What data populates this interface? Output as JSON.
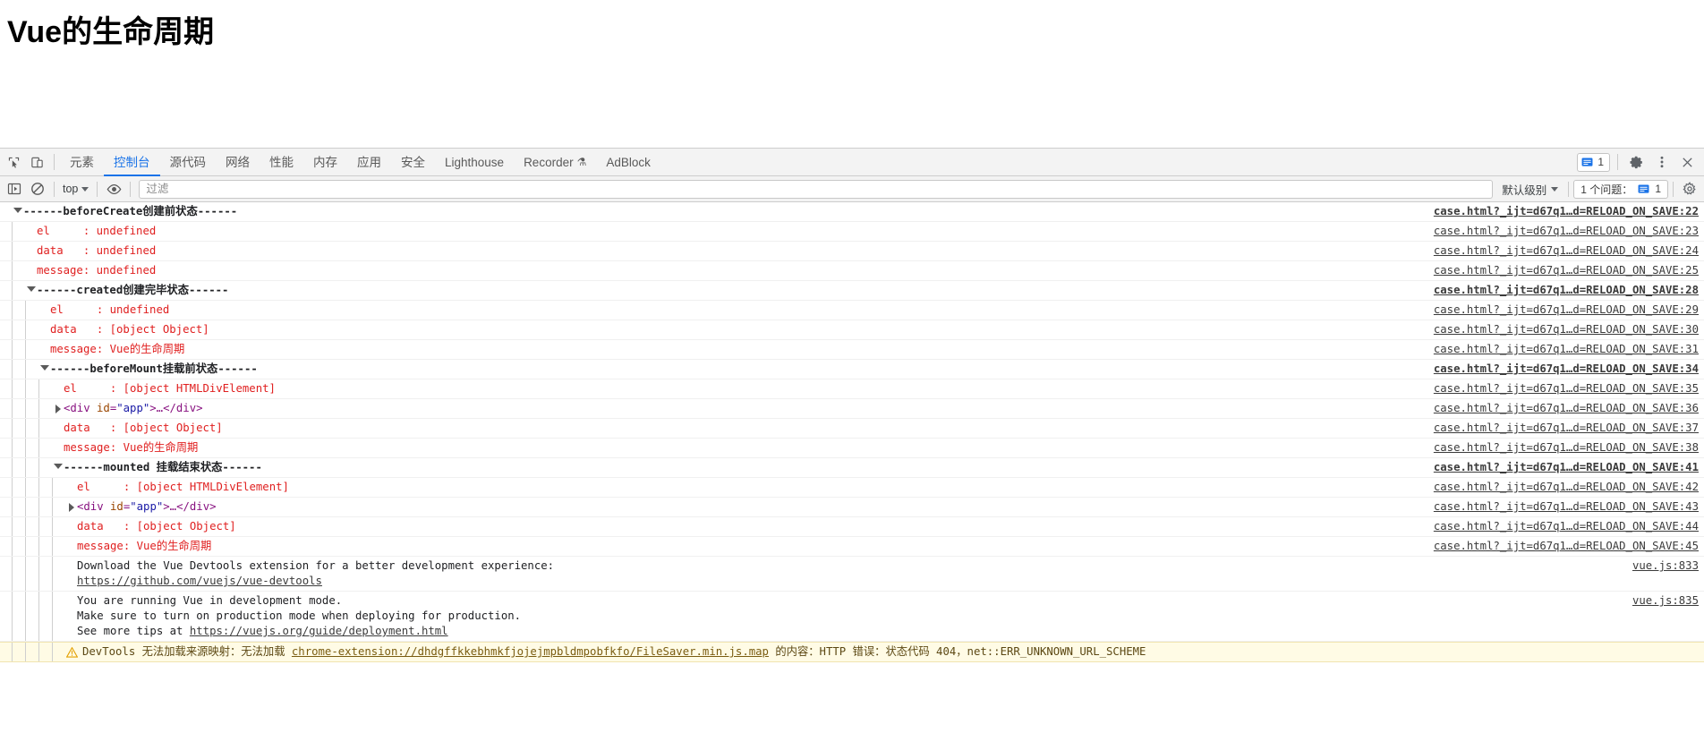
{
  "page": {
    "title": "Vue的生命周期"
  },
  "devtools": {
    "toolbar": {
      "inspect_icon": "inspect-cursor-icon",
      "device_toolbar_icon": "device-toggle-icon",
      "tabs": [
        {
          "label": "元素",
          "active": false
        },
        {
          "label": "控制台",
          "active": true
        },
        {
          "label": "源代码",
          "active": false
        },
        {
          "label": "网络",
          "active": false
        },
        {
          "label": "性能",
          "active": false
        },
        {
          "label": "内存",
          "active": false
        },
        {
          "label": "应用",
          "active": false
        },
        {
          "label": "安全",
          "active": false
        },
        {
          "label": "Lighthouse",
          "active": false
        },
        {
          "label": "Recorder",
          "active": false,
          "badge": "⚗"
        },
        {
          "label": "AdBlock",
          "active": false
        }
      ],
      "message_count": "1",
      "settings_icon": "gear-icon",
      "more_icon": "more-vertical-icon",
      "close_icon": "close-icon"
    },
    "filterbar": {
      "sidebar_icon": "console-sidebar-icon",
      "clear_icon": "clear-console-icon",
      "context": "top",
      "eye_icon": "live-expression-eye-icon",
      "filter_placeholder": "过滤",
      "filter_value": "",
      "level": "默认级别",
      "issues_label": "1 个问题：",
      "issues_count": "1",
      "settings_icon": "gear-icon"
    },
    "console": {
      "rows": [
        {
          "id": "r1",
          "indent": 0,
          "disclosure": "down",
          "kind": "group",
          "text": "------beforeCreate创建前状态------",
          "source": "case.html?_ijt=d67q1…d=RELOAD_ON_SAVE:22",
          "source_bold": true
        },
        {
          "id": "r2",
          "indent": 1,
          "disclosure": "none",
          "kind": "err",
          "text": "el     : undefined",
          "source": "case.html?_ijt=d67q1…d=RELOAD_ON_SAVE:23",
          "source_bold": false
        },
        {
          "id": "r3",
          "indent": 1,
          "disclosure": "none",
          "kind": "err",
          "text": "data   : undefined",
          "source": "case.html?_ijt=d67q1…d=RELOAD_ON_SAVE:24",
          "source_bold": false
        },
        {
          "id": "r4",
          "indent": 1,
          "disclosure": "none",
          "kind": "err",
          "text": "message: undefined",
          "source": "case.html?_ijt=d67q1…d=RELOAD_ON_SAVE:25",
          "source_bold": false
        },
        {
          "id": "r5",
          "indent": 1,
          "disclosure": "down",
          "kind": "group",
          "text": "------created创建完毕状态------",
          "source": "case.html?_ijt=d67q1…d=RELOAD_ON_SAVE:28",
          "source_bold": true
        },
        {
          "id": "r6",
          "indent": 2,
          "disclosure": "none",
          "kind": "err",
          "text": "el     : undefined",
          "source": "case.html?_ijt=d67q1…d=RELOAD_ON_SAVE:29",
          "source_bold": false
        },
        {
          "id": "r7",
          "indent": 2,
          "disclosure": "none",
          "kind": "err",
          "text": "data   : [object Object]",
          "source": "case.html?_ijt=d67q1…d=RELOAD_ON_SAVE:30",
          "source_bold": false
        },
        {
          "id": "r8",
          "indent": 2,
          "disclosure": "none",
          "kind": "err",
          "text": "message: Vue的生命周期",
          "source": "case.html?_ijt=d67q1…d=RELOAD_ON_SAVE:31",
          "source_bold": false
        },
        {
          "id": "r9",
          "indent": 2,
          "disclosure": "down",
          "kind": "group",
          "text": "------beforeMount挂载前状态------",
          "source": "case.html?_ijt=d67q1…d=RELOAD_ON_SAVE:34",
          "source_bold": true
        },
        {
          "id": "r10",
          "indent": 3,
          "disclosure": "none",
          "kind": "err",
          "text": "el     : [object HTMLDivElement]",
          "source": "case.html?_ijt=d67q1…d=RELOAD_ON_SAVE:35",
          "source_bold": false
        },
        {
          "id": "r11",
          "indent": 3,
          "disclosure": "right",
          "kind": "node",
          "node": {
            "open_tag": "<div ",
            "attr_name": "id",
            "eq": "=",
            "attr_value": "\"app\"",
            "gt": ">…</div>"
          },
          "source": "case.html?_ijt=d67q1…d=RELOAD_ON_SAVE:36",
          "source_bold": false
        },
        {
          "id": "r12",
          "indent": 3,
          "disclosure": "none",
          "kind": "err",
          "text": "data   : [object Object]",
          "source": "case.html?_ijt=d67q1…d=RELOAD_ON_SAVE:37",
          "source_bold": false
        },
        {
          "id": "r13",
          "indent": 3,
          "disclosure": "none",
          "kind": "err",
          "text": "message: Vue的生命周期",
          "source": "case.html?_ijt=d67q1…d=RELOAD_ON_SAVE:38",
          "source_bold": false
        },
        {
          "id": "r14",
          "indent": 3,
          "disclosure": "down",
          "kind": "group",
          "text": "------mounted 挂载结束状态------",
          "source": "case.html?_ijt=d67q1…d=RELOAD_ON_SAVE:41",
          "source_bold": true
        },
        {
          "id": "r15",
          "indent": 4,
          "disclosure": "none",
          "kind": "err",
          "text": "el     : [object HTMLDivElement]",
          "source": "case.html?_ijt=d67q1…d=RELOAD_ON_SAVE:42",
          "source_bold": false
        },
        {
          "id": "r16",
          "indent": 4,
          "disclosure": "right",
          "kind": "node",
          "node": {
            "open_tag": "<div ",
            "attr_name": "id",
            "eq": "=",
            "attr_value": "\"app\"",
            "gt": ">…</div>"
          },
          "source": "case.html?_ijt=d67q1…d=RELOAD_ON_SAVE:43",
          "source_bold": false
        },
        {
          "id": "r17",
          "indent": 4,
          "disclosure": "none",
          "kind": "err",
          "text": "data   : [object Object]",
          "source": "case.html?_ijt=d67q1…d=RELOAD_ON_SAVE:44",
          "source_bold": false
        },
        {
          "id": "r18",
          "indent": 4,
          "disclosure": "none",
          "kind": "err",
          "text": "message: Vue的生命周期",
          "source": "case.html?_ijt=d67q1…d=RELOAD_ON_SAVE:45",
          "source_bold": false
        },
        {
          "id": "r19",
          "indent": 4,
          "disclosure": "none",
          "kind": "devtools_tip",
          "line1": "Download the Vue Devtools extension for a better development experience:",
          "link": "https://github.com/vuejs/vue-devtools",
          "source": "vue.js:833",
          "source_bold": false
        },
        {
          "id": "r20",
          "indent": 4,
          "disclosure": "none",
          "kind": "devmode_tip",
          "line1": "You are running Vue in development mode.",
          "line2": "Make sure to turn on production mode when deploying for production.",
          "line3_prefix": "See more tips at ",
          "link": "https://vuejs.org/guide/deployment.html",
          "source": "vue.js:835",
          "source_bold": false
        },
        {
          "id": "r21",
          "indent": 4,
          "disclosure": "none",
          "kind": "warn",
          "warn_icon": "warning-triangle-icon",
          "prefix": "DevTools 无法加载来源映射：无法加载 ",
          "link": "chrome-extension://dhdgffkkebhmkfjojejmpbldmpobfkfo/FileSaver.min.js.map",
          "suffix": " 的内容：HTTP 错误：状态代码 404，net::ERR_UNKNOWN_URL_SCHEME",
          "source": "",
          "source_bold": false
        }
      ]
    }
  },
  "colors": {
    "accent": "#1a73e8",
    "error": "#e02020",
    "warn_bg": "#fffbe5",
    "toolbar_bg": "#f3f3f3",
    "node_tag": "#881280",
    "attr_name": "#994500",
    "attr_value": "#1a1aa6"
  }
}
